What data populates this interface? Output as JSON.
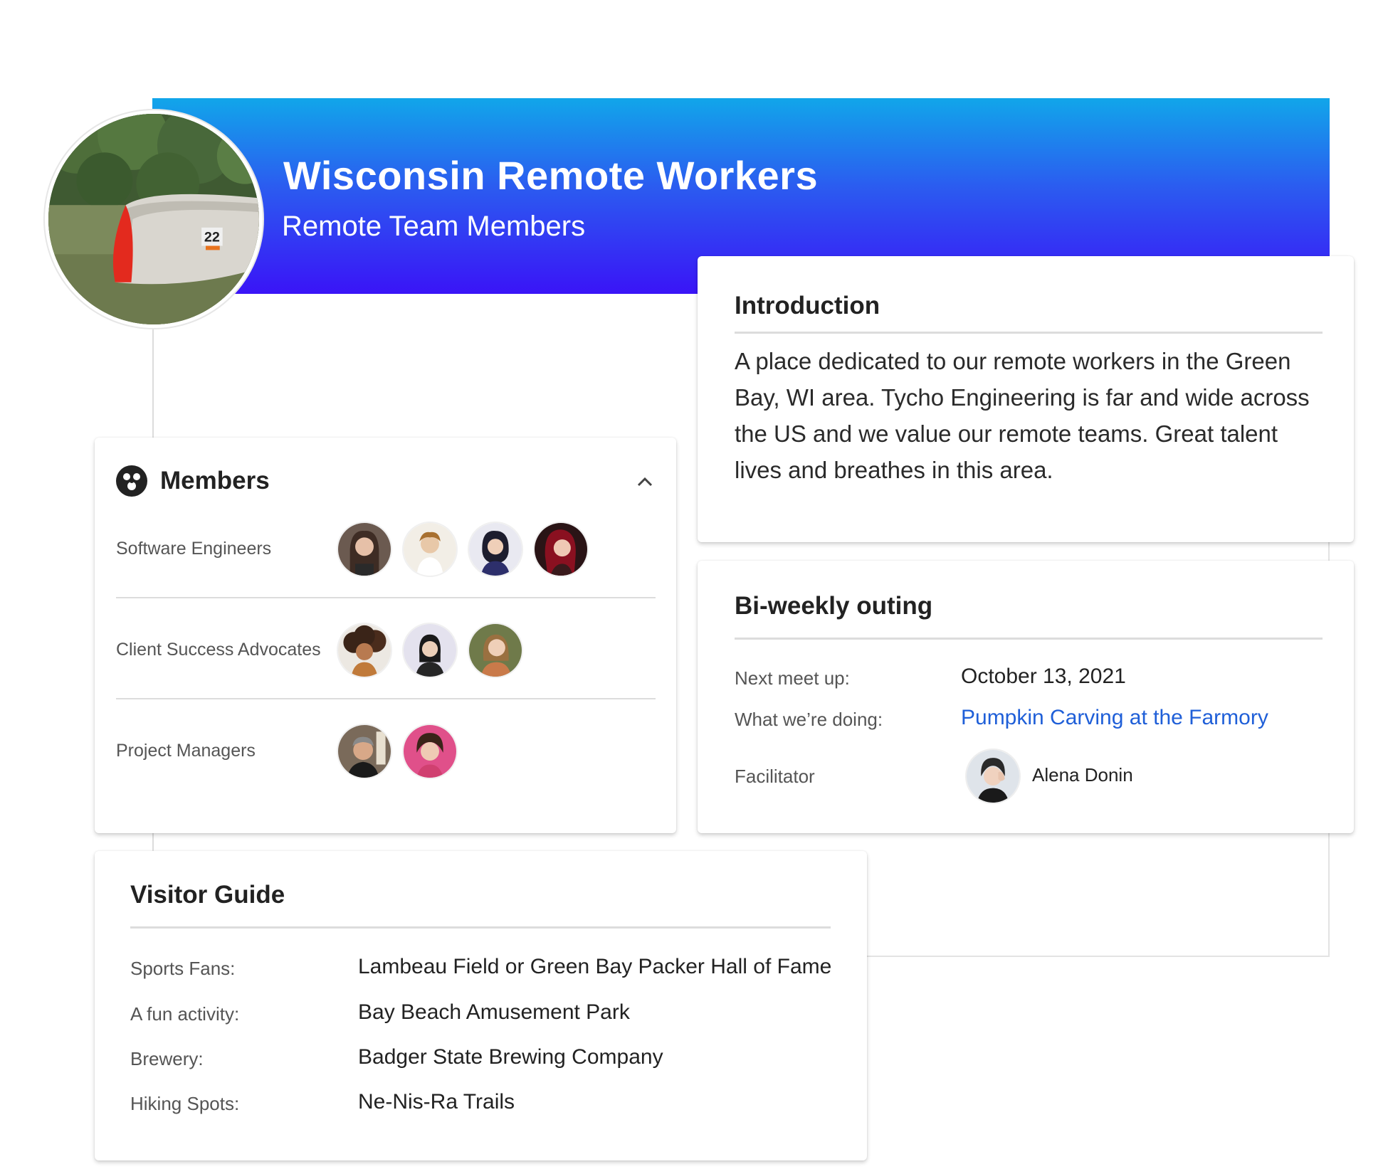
{
  "banner": {
    "title": "Wisconsin Remote Workers",
    "subtitle": "Remote Team Members",
    "gradient_top": "#11a6ea",
    "gradient_bottom": "#3a14f7"
  },
  "group_avatar": {
    "icon": "canoe-lake-photo",
    "canoe_number": "22"
  },
  "introduction": {
    "title": "Introduction",
    "body": "A place dedicated to our remote workers in the Green Bay, WI area. Tycho Engineering is far and wide across the US and we value our remote teams. Great talent lives and breathes in this area."
  },
  "members": {
    "title": "Members",
    "icon": "members-group-icon",
    "collapse_icon": "chevron-up-icon",
    "groups": [
      {
        "label": "Software Engineers",
        "avatar_colors": [
          "#6b5a50",
          "#e8dccb",
          "#2d2f6b",
          "#7a1020"
        ]
      },
      {
        "label": "Client Success Advocates",
        "avatar_colors": [
          "#c07a3a",
          "#d9d6e6",
          "#8a7a4a"
        ]
      },
      {
        "label": "Project Managers",
        "avatar_colors": [
          "#8a7565",
          "#e0508a"
        ]
      }
    ]
  },
  "outing": {
    "title": "Bi-weekly outing",
    "next_label": "Next meet up:",
    "next_value": "October 13, 2021",
    "doing_label": "What we’re doing:",
    "doing_value": "Pumpkin Carving at the Farmory",
    "facilitator_label": "Facilitator",
    "facilitator_name": "Alena Donin",
    "link_color": "#1f5fd8"
  },
  "visitor_guide": {
    "title": "Visitor Guide",
    "rows": [
      {
        "label": "Sports Fans:",
        "value": "Lambeau Field or Green Bay Packer Hall of Fame"
      },
      {
        "label": "A fun activity:",
        "value": "Bay Beach Amusement Park"
      },
      {
        "label": "Brewery:",
        "value": "Badger State Brewing Company"
      },
      {
        "label": "Hiking Spots:",
        "value": "Ne-Nis-Ra Trails"
      }
    ]
  }
}
